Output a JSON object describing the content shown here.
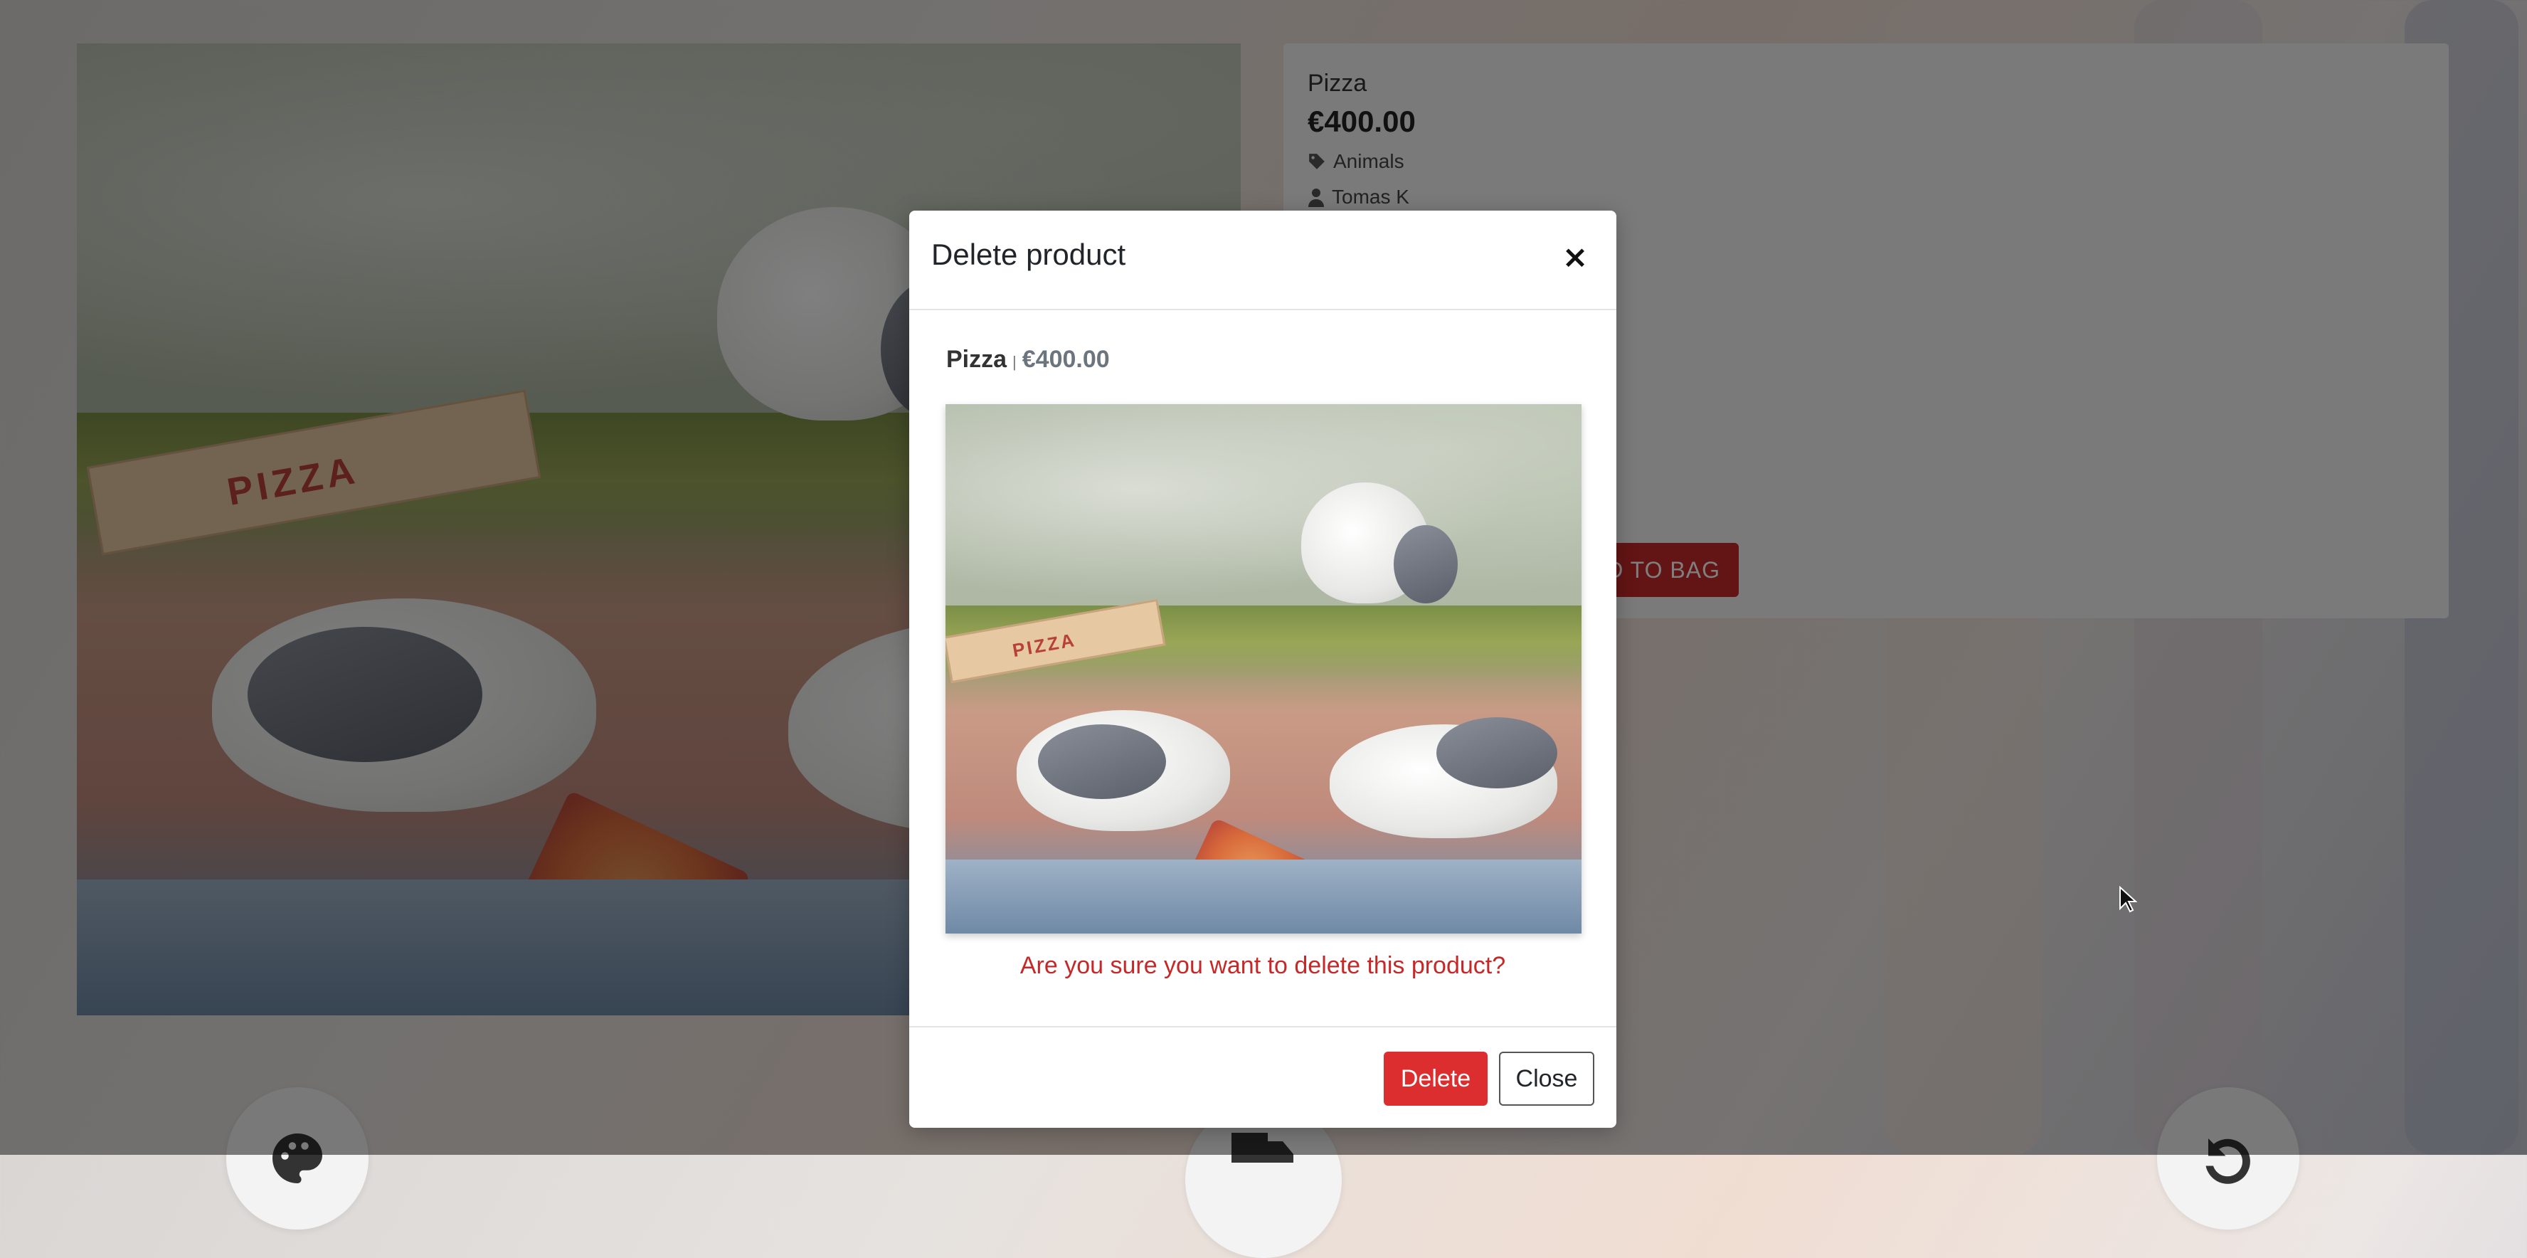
{
  "product": {
    "title": "Pizza",
    "price": "€400.00",
    "category": "Animals",
    "artist": "Tomas K",
    "add_to_bag_label": "D TO BAG"
  },
  "modal": {
    "title": "Delete product",
    "close_icon": "×",
    "product_name": "Pizza",
    "separator": "|",
    "product_price": "€400.00",
    "confirm_text": "Are you sure you want to delete this product?",
    "delete_label": "Delete",
    "close_label": "Close"
  },
  "painting": {
    "box_text": "PIZZA"
  },
  "icons": {
    "category": "tag-icon",
    "artist": "user-icon",
    "left_round": "palette-icon",
    "middle_round": "truck-icon",
    "right_round": "undo-icon"
  },
  "colors": {
    "delete": "#dc2e2e",
    "confirm_text": "#c62828",
    "bag_button": "#c62828"
  }
}
